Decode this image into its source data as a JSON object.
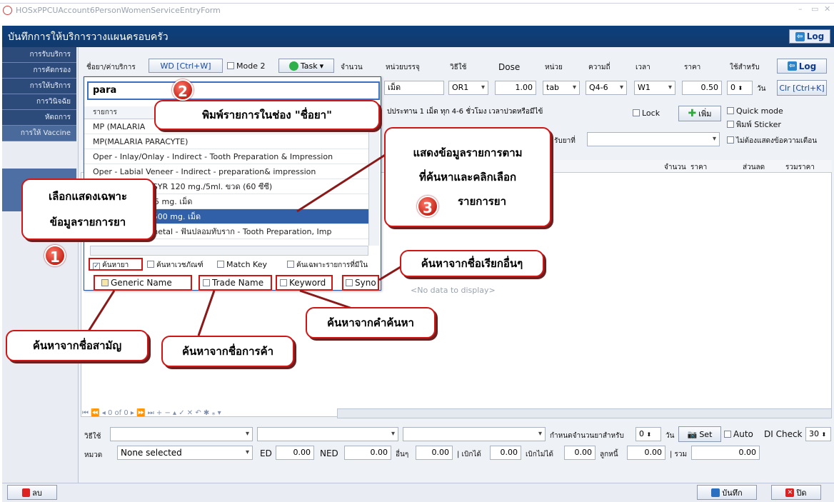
{
  "window": {
    "title": "HOSxPPCUAccount6PersonWomenServiceEntryForm"
  },
  "header": {
    "title": "บันทึกการให้บริการวางแผนครอบครัว",
    "log_label": "Log"
  },
  "sidebar": {
    "items": [
      "การรับบริการ",
      "การคัดกรอง",
      "การให้บริการ",
      "การวินิจฉัย",
      "หัตถการ",
      "การให้ Vaccine"
    ]
  },
  "form": {
    "col_headers": [
      "ชื่อยา/ค่าบริการ",
      "จำนวน",
      "หน่วยบรรจุ",
      "วิธีใช้",
      "Dose",
      "หน่วย",
      "ความถี่",
      "เวลา",
      "ราคา",
      "ใช้สำหรับ"
    ],
    "wd_label": "WD [Ctrl+W]",
    "mode2_label": "Mode 2",
    "task_label": "Task",
    "log_label": "Log",
    "drug_input": "para",
    "unit_pack": "เม็ด",
    "usage": "OR1",
    "dose": "1.00",
    "unit": "tab",
    "freq": "Q4-6",
    "time": "W1",
    "price": "0.50",
    "use_for": "0",
    "day_label": "วัน",
    "clr_label": "Clr [Ctrl+K]",
    "instruction": "ปประทาน 1 เม็ด ทุก 4-6 ชั่วโมง เวลาปวดหรือมีไข้",
    "lock_label": "Lock",
    "add_label": "เพิ่ม",
    "quick_mode": "Quick mode",
    "print_sticker": "พิมพ์ Sticker",
    "no_warning": "ไม่ต้องแสดงข้อความเตือน",
    "receive_label": "รับยาที่"
  },
  "grid": {
    "headers": [
      "จำนวน",
      "ราคา",
      "ส่วนลด",
      "รวมราคา"
    ],
    "nodata": "<No data to display>",
    "nav": "0 of 0"
  },
  "popup": {
    "header": "รายการ",
    "items": [
      "MP (MALARIA",
      "MP(MALARIA PARACYTE)",
      "Oper - Inlay/Onlay - Indirect - Tooth Preparation & Impression",
      "Oper - Labial Veneer - Indirect - preparation& impression",
      "PARACETAMOL SYR 120 mg./5ml. ขวด (60 ซีซี)",
      "Paracetamol 325 mg. เม็ด",
      "PARACETAMOL 500 mg. เม็ด",
      "Post & Coping metal - ฟันปลอมทับราก - Tooth Preparation, Imp"
    ],
    "filters_row1": [
      "ค้นหายา",
      "ค้นหาเวชภัณฑ์",
      "Match Key",
      "ค้นเฉพาะรายการที่มีใน"
    ],
    "filters_row2": [
      "Generic Name",
      "Trade Name",
      "Keyword",
      "Syno"
    ]
  },
  "callouts": {
    "c2": "พิมพ์รายการในช่อง \"ชื่อยา\"",
    "c3_line1": "แสดงข้อมูลรายการตาม",
    "c3_line2": "ที่ค้นหาและคลิกเลือก",
    "c3_line3": "รายการยา",
    "c1_line1": "เลือกแสดงเฉพาะ",
    "c1_line2": "ข้อมูลรายการยา",
    "other_names": "ค้นหาจากชื่อเรียกอื่นๆ",
    "generic": "ค้นหาจากชื่อสามัญ",
    "trade": "ค้นหาจากชื่อการค้า",
    "keyword": "ค้นหาจากคำค้นหา",
    "n1": "1",
    "n2": "2",
    "n3": "3"
  },
  "bottom": {
    "usage_label": "วิธีใช้",
    "category_label": "หมวด",
    "category_value": "None selected",
    "ed_label": "ED",
    "ed": "0.00",
    "ned_label": "NED",
    "ned": "0.00",
    "other_label": "อื่นๆ",
    "other": "0.00",
    "claim_label": "| เบิกได้",
    "claim": "0.00",
    "noclaim_label": "เบิกไม่ได้",
    "noclaim": "0.00",
    "debt_label": "ลูกหนี้",
    "debt": "0.00",
    "total_label": "| รวม",
    "total": "0.00",
    "qty_days_label": "กำหนดจำนวนยาสำหรับ",
    "qty_days": "0",
    "day_label": "วัน",
    "set_label": "Set",
    "auto_label": "Auto",
    "di_label": "DI Check",
    "di_value": "30",
    "delete_label": "ลบ",
    "save_label": "บันทึก",
    "close_label": "ปิด"
  }
}
